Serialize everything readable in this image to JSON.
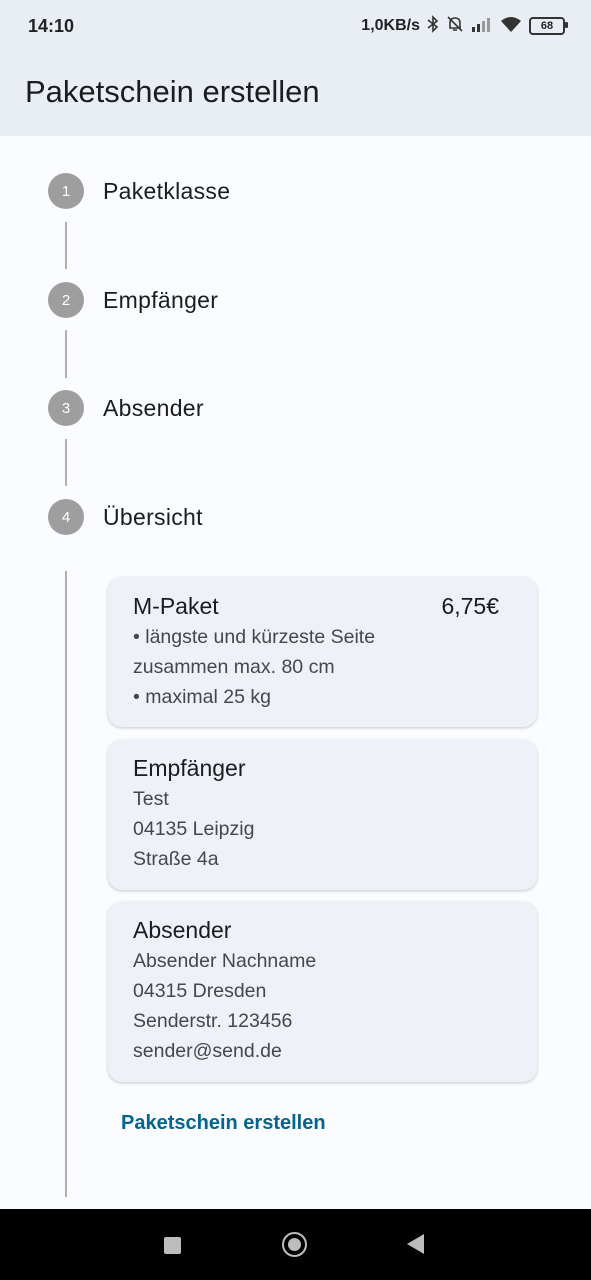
{
  "status_bar": {
    "time": "14:10",
    "network_speed": "1,0KB/s",
    "battery": "68",
    "icons": [
      "bluetooth-icon",
      "bell-muted-icon",
      "signal-icon",
      "wifi-icon",
      "battery-icon"
    ]
  },
  "app_bar": {
    "title": "Paketschein erstellen"
  },
  "steps": [
    {
      "number": "1",
      "label": "Paketklasse"
    },
    {
      "number": "2",
      "label": "Empfänger"
    },
    {
      "number": "3",
      "label": "Absender"
    },
    {
      "number": "4",
      "label": "Übersicht"
    }
  ],
  "summary": {
    "package": {
      "title": "M-Paket",
      "price": "6,75€",
      "lines": [
        "• längste und kürzeste Seite",
        "zusammen max. 80 cm",
        "• maximal 25 kg"
      ]
    },
    "recipient": {
      "title": "Empfänger",
      "lines": [
        "Test",
        "04135 Leipzig",
        "Straße  4a"
      ]
    },
    "sender": {
      "title": "Absender",
      "lines": [
        "Absender Nachname",
        "04315 Dresden",
        "Senderstr.  123456",
        "sender@send.de"
      ]
    },
    "action_label": "Paketschein erstellen"
  },
  "nav_bar": {
    "buttons": [
      "recents-button",
      "home-button",
      "back-button"
    ]
  }
}
